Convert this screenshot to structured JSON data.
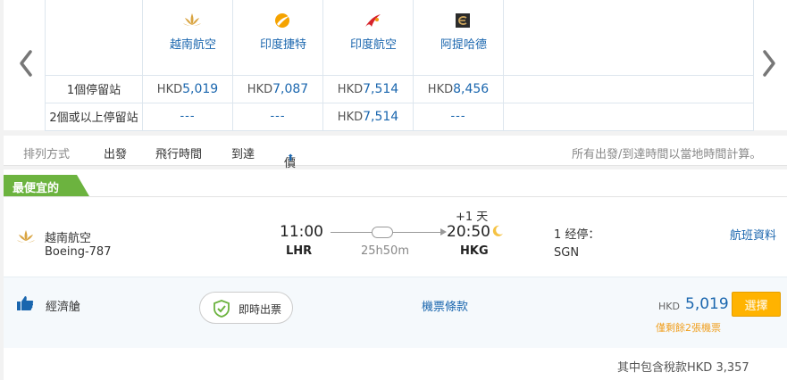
{
  "matrix": {
    "prev_icon": "chevron-left-icon",
    "next_icon": "chevron-right-icon",
    "airlines": [
      {
        "name": "越南航空",
        "logo": "lotus-logo",
        "logo_color": "#d9a441"
      },
      {
        "name": "印度捷特",
        "logo": "sun-logo",
        "logo_color": "#f5a300"
      },
      {
        "name": "印度航空",
        "logo": "swan-logo",
        "logo_color": "#d6232a"
      },
      {
        "name": "阿提哈德",
        "logo": "etihad-logo",
        "logo_color": "#b8935a"
      }
    ],
    "rows": [
      {
        "label": "1個停留站",
        "cells": [
          {
            "currency": "HKD",
            "amount": "5,019"
          },
          {
            "currency": "HKD",
            "amount": "7,087"
          },
          {
            "currency": "HKD",
            "amount": "7,514"
          },
          {
            "currency": "HKD",
            "amount": "8,456"
          }
        ]
      },
      {
        "label": "2個或以上停留站",
        "cells": [
          {
            "dash": "---"
          },
          {
            "dash": "---"
          },
          {
            "currency": "HKD",
            "amount": "7,514"
          },
          {
            "dash": "---"
          }
        ]
      }
    ]
  },
  "sort": {
    "label": "排列方式",
    "options": [
      "出發",
      "飛行時間",
      "到達",
      "價格"
    ],
    "active_arrow": "⬆",
    "note": "所有出發/到達時間以當地時間計算。"
  },
  "result": {
    "banner": "最便宜的",
    "banner_color": "#6cb33f",
    "airline": "越南航空",
    "aircraft": "Boeing-787",
    "departure": {
      "time": "11:00",
      "airport": "LHR"
    },
    "duration": "25h50m",
    "arrival": {
      "day_offset": "+1 天",
      "time": "20:50",
      "airport": "HKG"
    },
    "stops_label": "1 经停：",
    "stop_airport": "SGN",
    "flight_info": "航班資料",
    "cabin": "經濟艙",
    "instant_ticket": "即時出票",
    "fare_rules": "機票條款",
    "price_currency": "HKD",
    "price": "5,019",
    "select": "選擇",
    "seats_left": "僅剩餘2張機票",
    "tax_note": "其中包含稅款HKD 3,357"
  },
  "colors": {
    "link": "#1a66ae",
    "accent": "#ffb300",
    "warning": "#f0a020"
  }
}
